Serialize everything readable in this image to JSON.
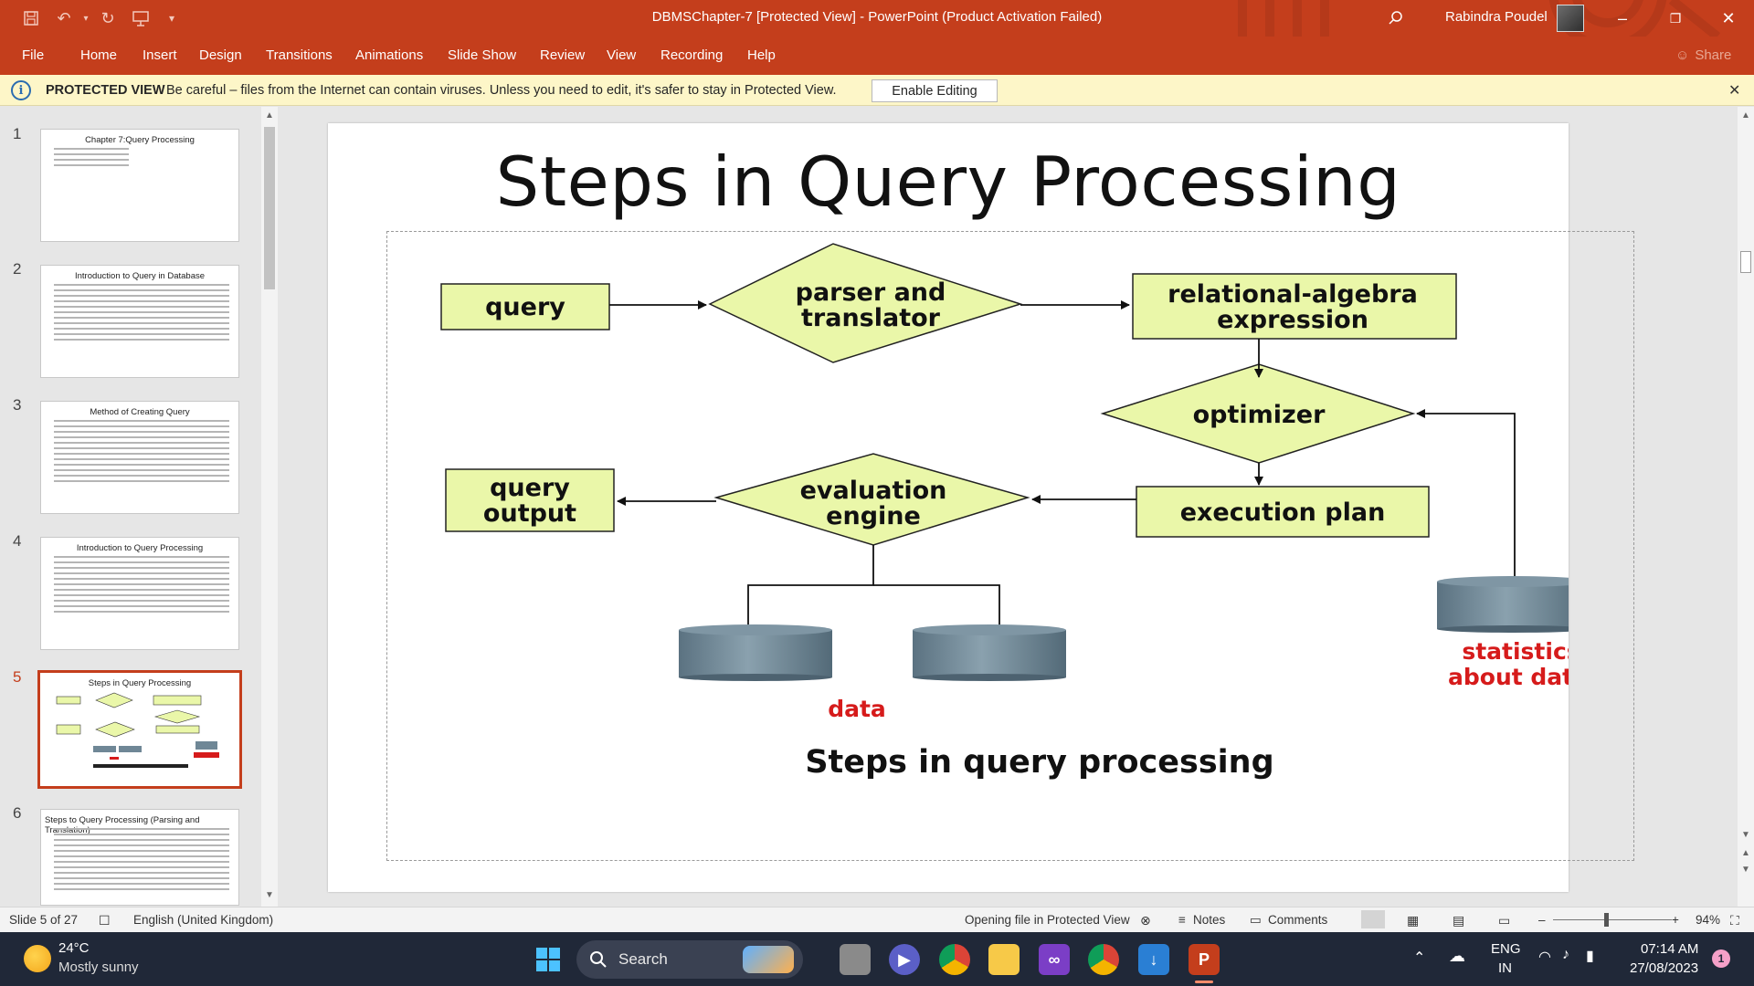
{
  "window": {
    "title": "DBMSChapter-7 [Protected View]  -  PowerPoint (Product Activation Failed)",
    "user": "Rabindra Poudel",
    "qat_icons": [
      "save-icon",
      "undo-icon",
      "redo-icon",
      "present-icon",
      "customize-icon"
    ]
  },
  "menu": {
    "tabs": [
      "File",
      "Home",
      "Insert",
      "Design",
      "Transitions",
      "Animations",
      "Slide Show",
      "Review",
      "View",
      "Recording",
      "Help"
    ],
    "share": "Share"
  },
  "protected_view": {
    "title": "PROTECTED VIEW",
    "message": "Be careful – files from the Internet can contain viruses. Unless you need to edit, it's safer to stay in Protected View.",
    "enable_button": "Enable Editing"
  },
  "thumbnails": [
    {
      "num": "1",
      "title": "Chapter 7:Query Processing"
    },
    {
      "num": "2",
      "title": "Introduction to Query in Database"
    },
    {
      "num": "3",
      "title": "Method of Creating Query"
    },
    {
      "num": "4",
      "title": "Introduction to Query Processing"
    },
    {
      "num": "5",
      "title": "Steps in Query Processing"
    },
    {
      "num": "6",
      "title": "Steps to Query Processing (Parsing and Translation)"
    }
  ],
  "slide": {
    "title": "Steps in Query Processing",
    "diagram": {
      "query": "query",
      "parser_1": "parser and",
      "parser_2": "translator",
      "rae_1": "relational-algebra",
      "rae_2": "expression",
      "optimizer": "optimizer",
      "exec_plan": "execution plan",
      "eval_1": "evaluation",
      "eval_2": "engine",
      "qout_1": "query",
      "qout_2": "output",
      "data": "data",
      "stats_1": "statistics",
      "stats_2": "about data",
      "caption": "Steps in query processing"
    },
    "colors": {
      "box_fill": "#eaf7a9",
      "label_red": "#d61b1b",
      "cylinder": "#6f8796"
    }
  },
  "status": {
    "slide_of": "Slide 5 of 27",
    "language": "English (United Kingdom)",
    "opening": "Opening file in Protected View",
    "notes": "Notes",
    "comments": "Comments",
    "zoom": "94%"
  },
  "taskbar": {
    "temp": "24°C",
    "weather": "Mostly sunny",
    "search": "Search",
    "lang_1": "ENG",
    "lang_2": "IN",
    "time": "07:14 AM",
    "date": "27/08/2023",
    "notif": "1"
  }
}
